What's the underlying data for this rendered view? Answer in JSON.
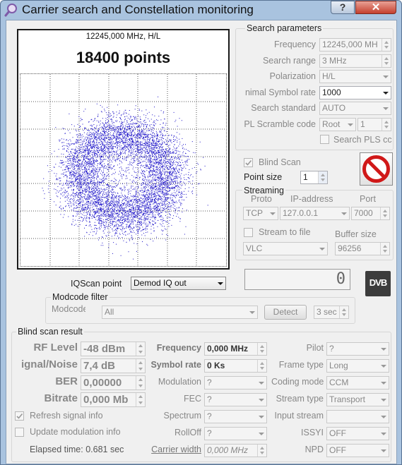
{
  "window": {
    "title": "Carrier search and Constellation monitoring",
    "help": "?",
    "close": "✕"
  },
  "constellation": {
    "freq_label": "12245,000 MHz, H/L",
    "points_label": "18400 points",
    "point_color": "#1a10c8",
    "seed": 20
  },
  "search_params": {
    "title": "Search parameters",
    "frequency_label": "Frequency",
    "frequency_value": "12245,000 MH",
    "search_range_label": "Search range",
    "search_range_value": "3 MHz",
    "polarization_label": "Polarization",
    "polarization_value": "H/L",
    "symbol_rate_label": "nimal Symbol rate",
    "symbol_rate_value": "1000",
    "search_standard_label": "Search standard",
    "search_standard_value": "AUTO",
    "pl_scramble_label": "PL Scramble code",
    "pl_scramble_mode": "Root",
    "pl_scramble_value": "1",
    "search_pls_label": "Search PLS cc"
  },
  "blind_scan_label": "Blind Scan",
  "point_size_label": "Point size",
  "point_size_value": "1",
  "streaming": {
    "title": "Streaming",
    "proto_label": "Proto",
    "ip_label": "IP-address",
    "port_label": "Port",
    "proto_value": "TCP",
    "ip_value": "127.0.0.1",
    "port_value": "7000",
    "stream_to_file_label": "Stream to file",
    "buffer_size_label": "Buffer size",
    "player_value": "VLC",
    "buffer_size_value": "96256"
  },
  "iqscan": {
    "label": "IQScan point",
    "value": "Demod IQ out"
  },
  "counter_value": "0",
  "dvb_logo": "DVB",
  "modcode": {
    "title": "Modcode filter",
    "label": "Modcode",
    "value": "All",
    "detect_label": "Detect",
    "timeout_value": "3 sec"
  },
  "result": {
    "title": "Blind scan result",
    "rf_level_label": "RF Level",
    "rf_level_value": "-48 dBm",
    "snr_label": "ignal/Noise",
    "snr_value": "7,4 dB",
    "ber_label": "BER",
    "ber_value": "0,00000",
    "bitrate_label": "Bitrate",
    "bitrate_value": "0,000 Mb",
    "frequency_label": "Frequency",
    "frequency_value": "0,000 MHz",
    "symbol_rate_label": "Symbol rate",
    "symbol_rate_value": "0 Ks",
    "modulation_label": "Modulation",
    "modulation_value": "?",
    "fec_label": "FEC",
    "fec_value": "?",
    "spectrum_label": "Spectrum",
    "spectrum_value": "?",
    "rolloff_label": "RollOff",
    "rolloff_value": "?",
    "carrier_width_label": "Carrier width",
    "carrier_width_value": "0,000 MHz",
    "pilot_label": "Pilot",
    "pilot_value": "?",
    "frame_type_label": "Frame type",
    "frame_type_value": "Long",
    "coding_mode_label": "Coding mode",
    "coding_mode_value": "CCM",
    "stream_type_label": "Stream type",
    "stream_type_value": "Transport",
    "input_stream_label": "Input stream",
    "input_stream_value": "",
    "issyi_label": "ISSYI",
    "issyi_value": "OFF",
    "npd_label": "NPD",
    "npd_value": "OFF",
    "refresh_label": "Refresh signal info",
    "update_label": "Update modulation info",
    "elapsed_label": "Elapsed time: 0.681 sec"
  }
}
